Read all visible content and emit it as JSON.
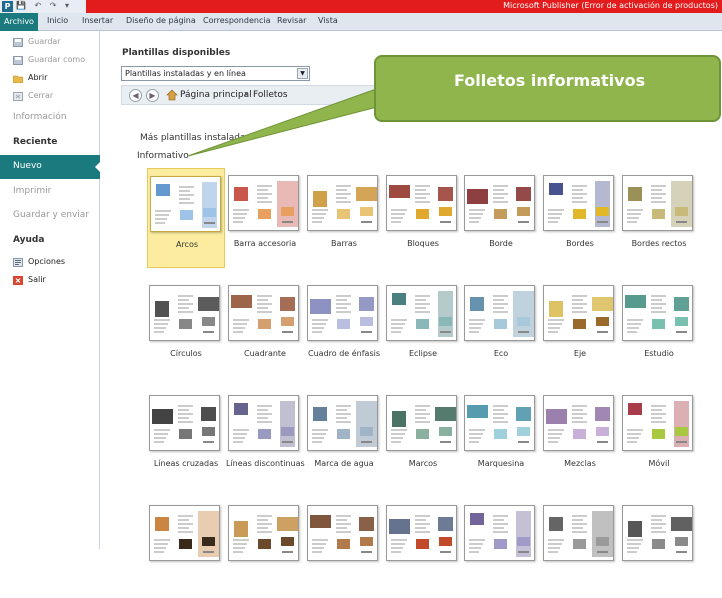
{
  "titlebar": {
    "app_icon": "P",
    "quick_access": "💾 ↶ ↷ ▾",
    "title": "Microsoft Publisher (Error de activación de productos)"
  },
  "ribbon": {
    "file_tab": "Archivo",
    "tabs": [
      "Inicio",
      "Insertar",
      "Diseño de página",
      "Correspondencia",
      "Revisar",
      "Vista"
    ]
  },
  "backstage": {
    "save": "Guardar",
    "save_as": "Guardar como",
    "open": "Abrir",
    "close": "Cerrar",
    "info": "Información",
    "recent": "Reciente",
    "new": "Nuevo",
    "print": "Imprimir",
    "save_send": "Guardar y enviar",
    "help": "Ayuda",
    "options": "Opciones",
    "exit": "Salir"
  },
  "main": {
    "available_title": "Plantillas disponibles",
    "source_select": "Plantillas instaladas y en línea",
    "breadcrumb_home": "Página principal",
    "breadcrumb_sep": "▸",
    "breadcrumb_current": "Folletos",
    "more_templates": "Más plantillas instaladas",
    "category": "Informativo"
  },
  "callout": {
    "text": "Folletos informativos"
  },
  "templates": [
    {
      "name": "Arcos",
      "accent": "#4a86c5",
      "accent2": "#9fc3e6",
      "selected": true
    },
    {
      "name": "Barra accesoria",
      "accent": "#c0392b",
      "accent2": "#e8a060"
    },
    {
      "name": "Barras",
      "accent": "#c98f2c",
      "accent2": "#e8c476"
    },
    {
      "name": "Bloques",
      "accent": "#8e2a1f",
      "accent2": "#e0a92e"
    },
    {
      "name": "Borde",
      "accent": "#7a1d1d",
      "accent2": "#c39b5a"
    },
    {
      "name": "Bordes",
      "accent": "#27347a",
      "accent2": "#e0b82a"
    },
    {
      "name": "Bordes rectos",
      "accent": "#8a7d3a",
      "accent2": "#c8bb7a"
    },
    {
      "name": "Círculos",
      "accent": "#333333",
      "accent2": "#888888"
    },
    {
      "name": "Cuadrante",
      "accent": "#8c4a2a",
      "accent2": "#d4a070"
    },
    {
      "name": "Cuadro de énfasis",
      "accent": "#7a7fb8",
      "accent2": "#b9bde0"
    },
    {
      "name": "Eclipse",
      "accent": "#2a6a6a",
      "accent2": "#8ab8b8"
    },
    {
      "name": "Eco",
      "accent": "#4a7fa0",
      "accent2": "#a8c8dc"
    },
    {
      "name": "Eje",
      "accent": "#d8b84a",
      "accent2": "#9a6a2a"
    },
    {
      "name": "Estudio",
      "accent": "#3a8a7a",
      "accent2": "#7ac0b0"
    },
    {
      "name": "Líneas cruzadas",
      "accent": "#222222",
      "accent2": "#777777"
    },
    {
      "name": "Líneas discontinuas",
      "accent": "#4a4a7a",
      "accent2": "#9a9ac0"
    },
    {
      "name": "Marca de agua",
      "accent": "#4a6a8a",
      "accent2": "#a0b4c8"
    },
    {
      "name": "Marcos",
      "accent": "#2a5a4a",
      "accent2": "#8ab0a0"
    },
    {
      "name": "Marquesina",
      "accent": "#3a8aa0",
      "accent2": "#9fd0dc"
    },
    {
      "name": "Mezclas",
      "accent": "#8a6aa0",
      "accent2": "#c8b0d8"
    },
    {
      "name": "Móvil",
      "accent": "#9a1a2a",
      "accent2": "#a8c840"
    },
    {
      "name": "",
      "accent": "#c07020",
      "accent2": "#3a2a1a"
    },
    {
      "name": "",
      "accent": "#c08a3a",
      "accent2": "#6a4a2a"
    },
    {
      "name": "",
      "accent": "#6a3a1a",
      "accent2": "#b07a4a"
    },
    {
      "name": "",
      "accent": "#4a5a7a",
      "accent2": "#c04a2a"
    },
    {
      "name": "",
      "accent": "#5a4a8a",
      "accent2": "#a09ac8"
    },
    {
      "name": "",
      "accent": "#4a4a4a",
      "accent2": "#9a9a9a"
    },
    {
      "name": "",
      "accent": "#3a3a3a",
      "accent2": "#8a8a8a"
    }
  ]
}
